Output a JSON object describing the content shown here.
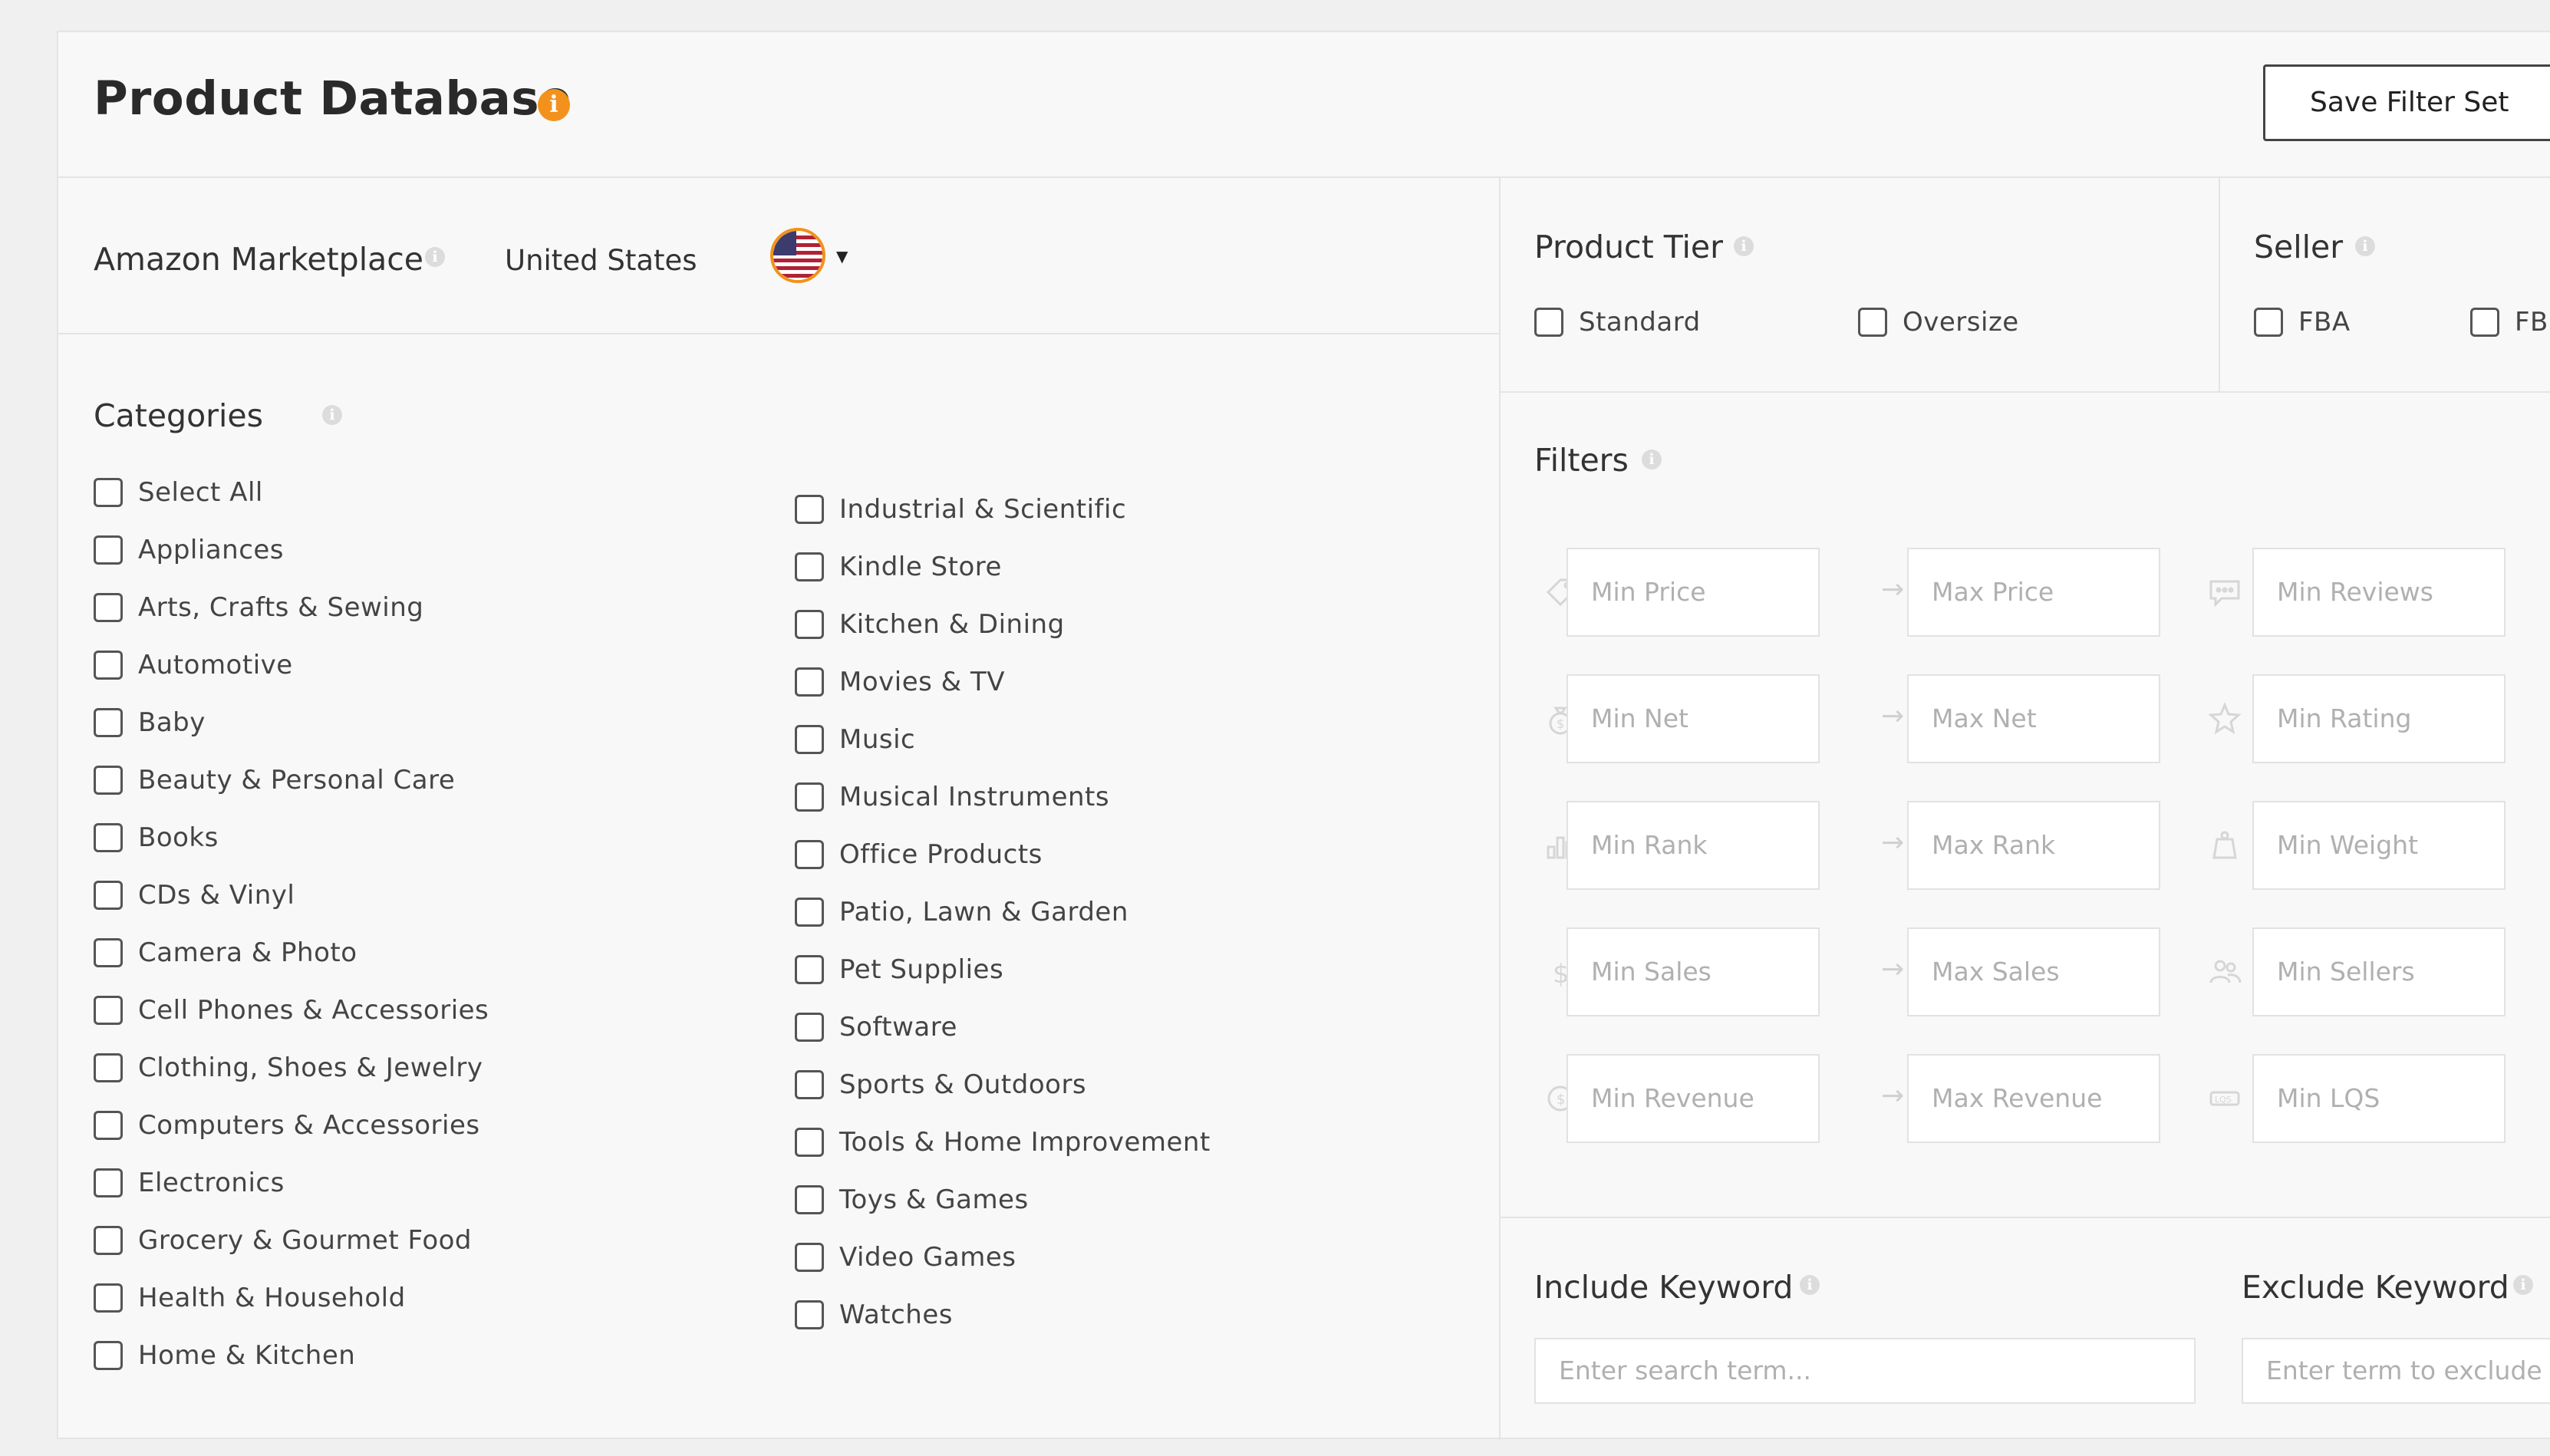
{
  "header": {
    "title": "Product Database",
    "save_button": "Save Filter Set"
  },
  "marketplace": {
    "label": "Amazon Marketplace",
    "value": "United States",
    "flag_icon": "us-flag-icon"
  },
  "categories": {
    "label": "Categories",
    "col1": [
      "Select All",
      "Appliances",
      "Arts, Crafts & Sewing",
      "Automotive",
      "Baby",
      "Beauty & Personal Care",
      "Books",
      "CDs & Vinyl",
      "Camera & Photo",
      "Cell Phones & Accessories",
      "Clothing, Shoes & Jewelry",
      "Computers & Accessories",
      "Electronics",
      "Grocery & Gourmet Food",
      "Health & Household",
      "Home & Kitchen"
    ],
    "col2": [
      "Industrial & Scientific",
      "Kindle Store",
      "Kitchen & Dining",
      "Movies & TV",
      "Music",
      "Musical Instruments",
      "Office Products",
      "Patio, Lawn & Garden",
      "Pet Supplies",
      "Software",
      "Sports & Outdoors",
      "Tools & Home Improvement",
      "Toys & Games",
      "Video Games",
      "Watches"
    ]
  },
  "product_tier": {
    "label": "Product Tier",
    "options": [
      "Standard",
      "Oversize"
    ]
  },
  "seller": {
    "label": "Seller",
    "options": [
      "FBA",
      "FB"
    ]
  },
  "filters": {
    "label": "Filters",
    "rows": [
      {
        "icon": "price-tag-icon",
        "min": "Min Price",
        "max": "Max Price",
        "icon2": "reviews-icon",
        "extra": "Min Reviews"
      },
      {
        "icon": "money-bag-icon",
        "min": "Min Net",
        "max": "Max Net",
        "icon2": "star-icon",
        "extra": "Min Rating"
      },
      {
        "icon": "bar-chart-icon",
        "min": "Min Rank",
        "max": "Max Rank",
        "icon2": "weight-icon",
        "extra": "Min Weight"
      },
      {
        "icon": "dollar-icon",
        "min": "Min Sales",
        "max": "Max Sales",
        "icon2": "sellers-icon",
        "extra": "Min Sellers"
      },
      {
        "icon": "revenue-icon",
        "min": "Min Revenue",
        "max": "Max Revenue",
        "icon2": "lqs-icon",
        "extra": "Min LQS"
      }
    ]
  },
  "include_keyword": {
    "label": "Include Keyword",
    "placeholder": "Enter search term..."
  },
  "exclude_keyword": {
    "label": "Exclude Keyword",
    "placeholder": "Enter term to exclude"
  },
  "colors": {
    "accent": "#f2921c",
    "border": "#e4e4e4",
    "background": "#f8f8f8"
  }
}
